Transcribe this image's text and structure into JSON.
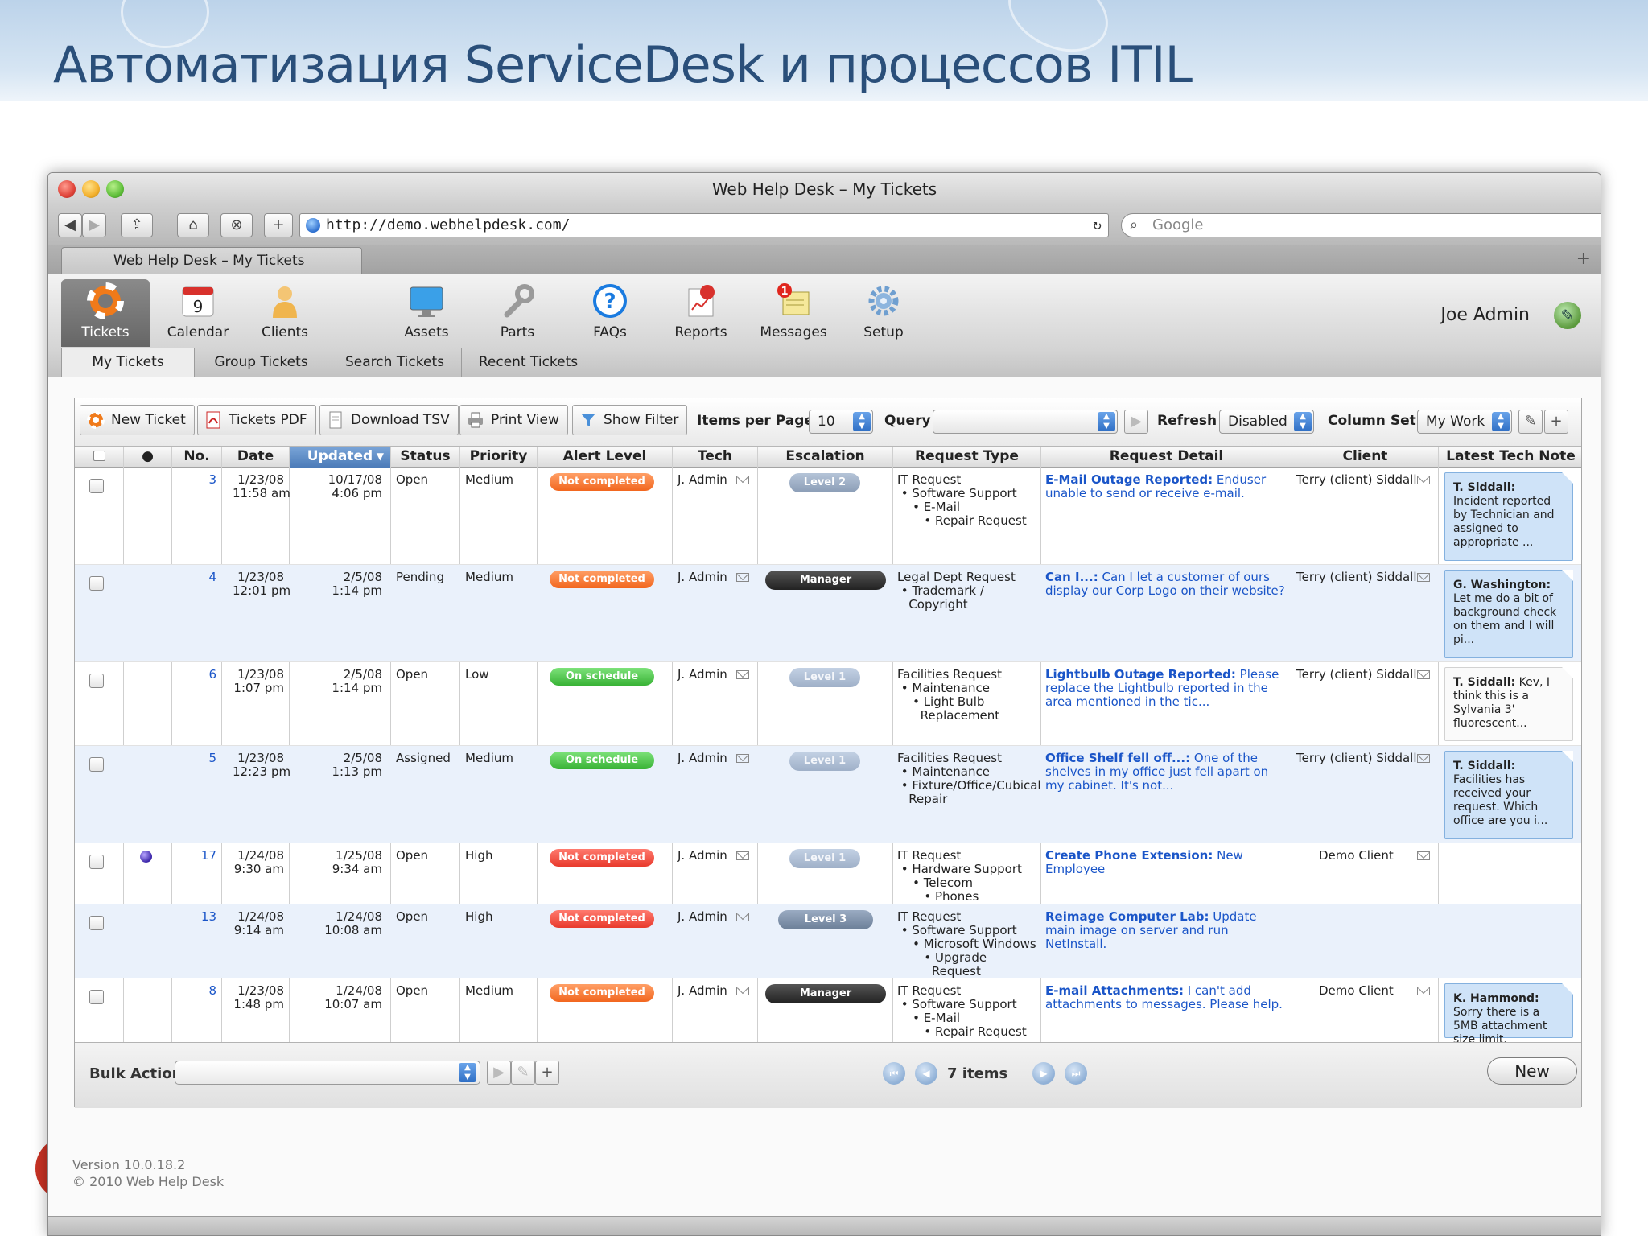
{
  "slide": {
    "title": "Автоматизация ServiceDesk и процессов ITIL"
  },
  "browser": {
    "window_title": "Web Help Desk – My Tickets",
    "url": "http://demo.webhelpdesk.com/",
    "search_placeholder": "Google",
    "tab_title": "Web Help Desk – My Tickets"
  },
  "app_nav": {
    "items": [
      {
        "label": "Tickets",
        "icon": "lifebuoy-icon",
        "active": true
      },
      {
        "label": "Calendar",
        "icon": "calendar-icon",
        "calendar_day": "9"
      },
      {
        "label": "Clients",
        "icon": "person-icon"
      },
      {
        "label": "Assets",
        "icon": "monitor-icon"
      },
      {
        "label": "Parts",
        "icon": "wrench-icon"
      },
      {
        "label": "FAQs",
        "icon": "question-icon"
      },
      {
        "label": "Reports",
        "icon": "reports-icon"
      },
      {
        "label": "Messages",
        "icon": "messages-icon",
        "badge": "1"
      },
      {
        "label": "Setup",
        "icon": "gear-icon"
      }
    ],
    "user_name": "Joe Admin"
  },
  "sub_tabs": [
    "My Tickets",
    "Group Tickets",
    "Search Tickets",
    "Recent Tickets"
  ],
  "action_bar": {
    "new_ticket": "New Ticket",
    "tickets_pdf": "Tickets PDF",
    "download_tsv": "Download TSV",
    "print_view": "Print View",
    "show_filter": "Show Filter",
    "items_per_page_label": "Items per Page",
    "items_per_page_value": "10",
    "query_label": "Query",
    "query_value": "",
    "refresh_label": "Refresh",
    "refresh_value": "Disabled",
    "column_set_label": "Column Set",
    "column_set_value": "My Work"
  },
  "columns": [
    "",
    "●",
    "No.",
    "Date",
    "Updated",
    "Status",
    "Priority",
    "Alert Level",
    "Tech",
    "Escalation",
    "Request Type",
    "Request Detail",
    "Client",
    "Latest Tech Note"
  ],
  "rows": [
    {
      "no": "3",
      "date1": "1/23/08",
      "date2": "11:58 am",
      "upd1": "10/17/08",
      "upd2": "4:06 pm",
      "status": "Open",
      "priority": "Medium",
      "alert": "Not completed",
      "alert_color": "#f26d22",
      "tech": "J. Admin",
      "escalation": "Level 2",
      "request_type": "IT Request\n • Software Support\n    • E-Mail\n       • Repair Request",
      "detail_title": "E-Mail Outage Reported:",
      "detail_text": " Enduser unable to send or receive e-mail.",
      "client": "Terry (client) Siddall",
      "note_author": "T. Siddall:",
      "note_text": " Incident reported by Technician and assigned to appropriate ..."
    },
    {
      "no": "4",
      "date1": "1/23/08",
      "date2": "12:01 pm",
      "upd1": "2/5/08",
      "upd2": "1:14 pm",
      "status": "Pending",
      "priority": "Medium",
      "alert": "Not completed",
      "alert_color": "#f26d22",
      "tech": "J. Admin",
      "escalation": "Manager",
      "request_type": "Legal Dept Request\n • Trademark /\n   Copyright",
      "detail_title": "Can I...:",
      "detail_text": " Can I let a customer of ours display our Corp Logo on their website?",
      "client": "Terry (client) Siddall",
      "note_author": "G. Washington:",
      "note_text": " Let me do a bit of background check on them and I will pi..."
    },
    {
      "no": "6",
      "date1": "1/23/08",
      "date2": "1:07 pm",
      "upd1": "2/5/08",
      "upd2": "1:14 pm",
      "status": "Open",
      "priority": "Low",
      "alert": "On schedule",
      "alert_color": "#3fb53b",
      "tech": "J. Admin",
      "escalation": "Level 1",
      "request_type": "Facilities Request\n • Maintenance\n    • Light Bulb\n      Replacement",
      "detail_title": "Lightbulb Outage Reported:",
      "detail_text": " Please replace the Lightbulb reported in the area mentioned in the tic...",
      "client": "Terry (client) Siddall",
      "note_author": "T. Siddall:",
      "note_text": " Kev, I think this is a Sylvania 3' fluorescent..."
    },
    {
      "no": "5",
      "date1": "1/23/08",
      "date2": "12:23 pm",
      "upd1": "2/5/08",
      "upd2": "1:13 pm",
      "status": "Assigned",
      "priority": "Medium",
      "alert": "On schedule",
      "alert_color": "#3fb53b",
      "tech": "J. Admin",
      "escalation": "Level 1",
      "request_type": "Facilities Request\n • Maintenance\n • Fixture/Office/Cubical\n   Repair",
      "detail_title": "Office Shelf fell off...:",
      "detail_text": " One of the shelves in my office just fell apart on my cabinet. It's not...",
      "client": "Terry (client) Siddall",
      "note_author": "T. Siddall:",
      "note_text": " Facilities has received your request. Which office are you i..."
    },
    {
      "no": "17",
      "date1": "1/24/08",
      "date2": "9:30 am",
      "upd1": "1/25/08",
      "upd2": "9:34 am",
      "status": "Open",
      "priority": "High",
      "alert": "Not completed",
      "alert_color": "#eb3d2f",
      "tech": "J. Admin",
      "escalation": "Level 1",
      "request_type": "IT Request\n • Hardware Support\n    • Telecom\n       • Phones",
      "detail_title": "Create Phone Extension:",
      "detail_text": " New Employee",
      "client": "Demo Client",
      "note_author": "",
      "note_text": ""
    },
    {
      "no": "13",
      "date1": "1/24/08",
      "date2": "9:14 am",
      "upd1": "1/24/08",
      "upd2": "10:08 am",
      "status": "Open",
      "priority": "High",
      "alert": "Not completed",
      "alert_color": "#eb3d2f",
      "tech": "J. Admin",
      "escalation": "Level 3",
      "request_type": "IT Request\n • Software Support\n    • Microsoft Windows\n       • Upgrade\n         Request",
      "detail_title": "Reimage Computer Lab:",
      "detail_text": " Update main image on server and run NetInstall.",
      "client": "",
      "note_author": "",
      "note_text": ""
    },
    {
      "no": "8",
      "date1": "1/23/08",
      "date2": "1:48 pm",
      "upd1": "1/24/08",
      "upd2": "10:07 am",
      "status": "Open",
      "priority": "Medium",
      "alert": "Not completed",
      "alert_color": "#f26d22",
      "tech": "J. Admin",
      "escalation": "Manager",
      "request_type": "IT Request\n • Software Support\n    • E-Mail\n       • Repair Request",
      "detail_title": "E-mail Attachments:",
      "detail_text": " I can't add attachments to messages. Please help.",
      "client": "Demo Client",
      "note_author": "K. Hammond:",
      "note_text": " Sorry there is a 5MB attachment size limit."
    }
  ],
  "footer": {
    "bulk_action_label": "Bulk Action",
    "items_count": "7 items",
    "new_button": "New",
    "version": "Version 10.0.18.2",
    "copyright": "© 2010 Web Help Desk"
  }
}
